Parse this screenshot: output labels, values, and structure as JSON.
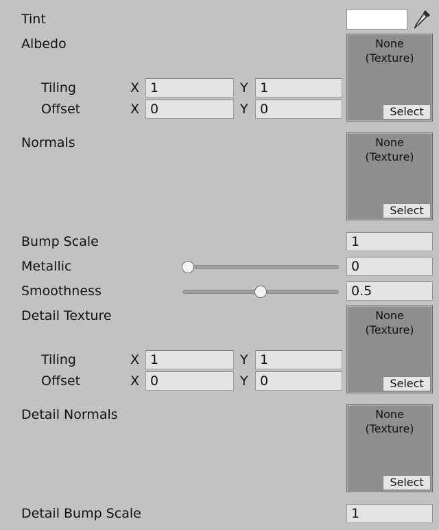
{
  "tint": {
    "label": "Tint",
    "color": "#ffffff",
    "picker_icon": "eyedropper-icon"
  },
  "albedo": {
    "label": "Albedo",
    "texture": {
      "name": "None\n(Texture)",
      "select_label": "Select"
    },
    "tiling": {
      "label": "Tiling",
      "x_axis": "X",
      "y_axis": "Y",
      "x": "1",
      "y": "1"
    },
    "offset": {
      "label": "Offset",
      "x_axis": "X",
      "y_axis": "Y",
      "x": "0",
      "y": "0"
    }
  },
  "normals": {
    "label": "Normals",
    "texture": {
      "name": "None\n(Texture)",
      "select_label": "Select"
    }
  },
  "bump_scale": {
    "label": "Bump Scale",
    "value": "1"
  },
  "metallic": {
    "label": "Metallic",
    "value": "0",
    "level": 0.0
  },
  "smoothness": {
    "label": "Smoothness",
    "value": "0.5",
    "level": 0.5
  },
  "detail_texture": {
    "label": "Detail Texture",
    "texture": {
      "name": "None\n(Texture)",
      "select_label": "Select"
    },
    "tiling": {
      "label": "Tiling",
      "x_axis": "X",
      "y_axis": "Y",
      "x": "1",
      "y": "1"
    },
    "offset": {
      "label": "Offset",
      "x_axis": "X",
      "y_axis": "Y",
      "x": "0",
      "y": "0"
    }
  },
  "detail_normals": {
    "label": "Detail Normals",
    "texture": {
      "name": "None\n(Texture)",
      "select_label": "Select"
    }
  },
  "detail_bump_scale": {
    "label": "Detail Bump Scale",
    "value": "1"
  }
}
